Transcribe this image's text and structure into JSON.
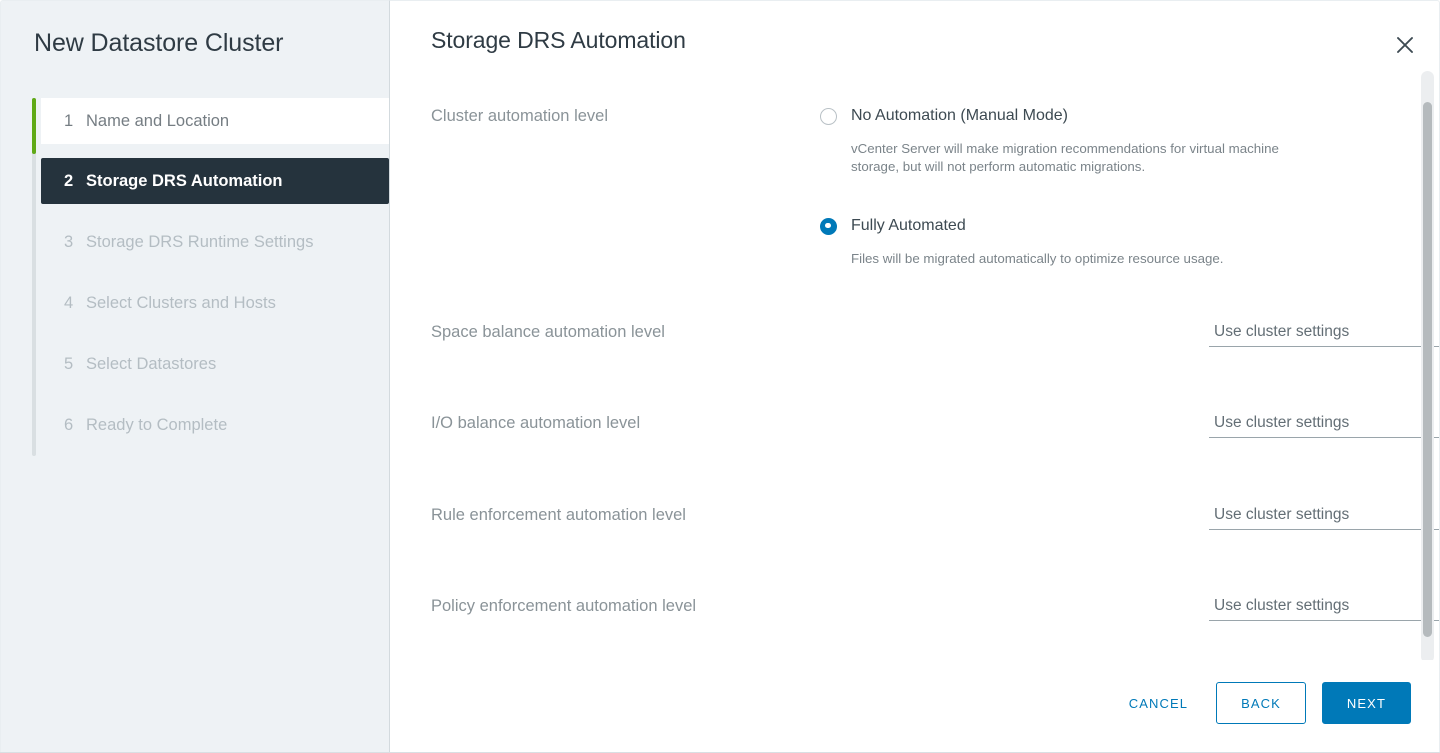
{
  "wizard": {
    "title": "New Datastore Cluster",
    "steps": [
      {
        "number": "1",
        "label": "Name and Location",
        "state": "done"
      },
      {
        "number": "2",
        "label": "Storage DRS Automation",
        "state": "current"
      },
      {
        "number": "3",
        "label": "Storage DRS Runtime Settings",
        "state": "upcoming"
      },
      {
        "number": "4",
        "label": "Select Clusters and Hosts",
        "state": "upcoming"
      },
      {
        "number": "5",
        "label": "Select Datastores",
        "state": "upcoming"
      },
      {
        "number": "6",
        "label": "Ready to Complete",
        "state": "upcoming"
      }
    ]
  },
  "page": {
    "heading": "Storage DRS Automation",
    "close_icon": "close-icon"
  },
  "cluster_automation": {
    "label": "Cluster automation level",
    "options": [
      {
        "label": "No Automation (Manual Mode)",
        "description": "vCenter Server will make migration recommendations for virtual machine storage, but will not perform automatic migrations.",
        "selected": false
      },
      {
        "label": "Fully Automated",
        "description": "Files will be migrated automatically to optimize resource usage.",
        "selected": true
      }
    ]
  },
  "automation_selects": [
    {
      "label": "Space balance automation level",
      "value": "Use cluster settings",
      "caret_icon": "chevron-down-icon",
      "info_icon": "info-circle-icon"
    },
    {
      "label": "I/O balance automation level",
      "value": "Use cluster settings",
      "caret_icon": "chevron-down-icon",
      "info_icon": "info-circle-icon"
    },
    {
      "label": "Rule enforcement automation level",
      "value": "Use cluster settings",
      "caret_icon": "chevron-down-icon",
      "info_icon": "info-circle-icon"
    },
    {
      "label": "Policy enforcement automation level",
      "value": "Use cluster settings",
      "caret_icon": "chevron-down-icon",
      "info_icon": "info-circle-icon"
    }
  ],
  "footer": {
    "cancel_label": "CANCEL",
    "back_label": "BACK",
    "next_label": "NEXT"
  },
  "colors": {
    "accent": "#0079b8",
    "progress_green": "#60a917",
    "current_step_bg": "#25333d",
    "panel_bg": "#eef2f5"
  }
}
